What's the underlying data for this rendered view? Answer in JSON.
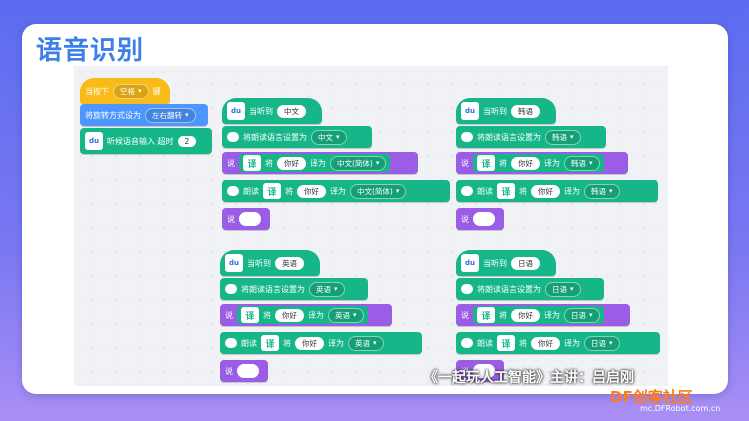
{
  "slide": {
    "title": "语音识别"
  },
  "left_stack": {
    "when_key": "当按下",
    "key_value": "空格",
    "key_suffix": "键",
    "rotate_label": "将旋转方式设为",
    "rotate_value": "左右翻转",
    "listen_label": "听候语音输入 超时",
    "listen_timeout": "2"
  },
  "groups": [
    {
      "heard_label": "当听到",
      "heard_value": "中文",
      "set_lang_label": "将朗读语言设置为",
      "set_lang_value": "中文",
      "say_label": "说",
      "translate_prefix": "将",
      "phrase": "你好",
      "translate_mid": "译为",
      "target": "中文(简体)",
      "read_label": "朗读",
      "read_target": "中文(简体)",
      "say2_label": "说"
    },
    {
      "heard_label": "当听到",
      "heard_value": "韩语",
      "set_lang_label": "将朗读语言设置为",
      "set_lang_value": "韩语",
      "say_label": "说",
      "translate_prefix": "将",
      "phrase": "你好",
      "translate_mid": "译为",
      "target": "韩语",
      "read_label": "朗读",
      "read_target": "韩语",
      "say2_label": "说"
    },
    {
      "heard_label": "当听到",
      "heard_value": "英语",
      "set_lang_label": "将朗读语言设置为",
      "set_lang_value": "英语",
      "say_label": "说",
      "translate_prefix": "将",
      "phrase": "你好",
      "translate_mid": "译为",
      "target": "英语",
      "read_label": "朗读",
      "read_target": "英语",
      "say2_label": "说"
    },
    {
      "heard_label": "当听到",
      "heard_value": "日语",
      "set_lang_label": "将朗读语言设置为",
      "set_lang_value": "日语",
      "say_label": "说",
      "translate_prefix": "将",
      "phrase": "你好",
      "translate_mid": "译为",
      "target": "日语",
      "read_label": "朗读",
      "read_target": "日语",
      "say2_label": "说"
    }
  ],
  "footer": {
    "credit": "《一起玩人工智能》主讲：吕启刚",
    "logo": "DF创客社区",
    "site": "mc.DFRobot.com.cn"
  },
  "icons": {
    "baidu": "du",
    "translate": "译"
  }
}
